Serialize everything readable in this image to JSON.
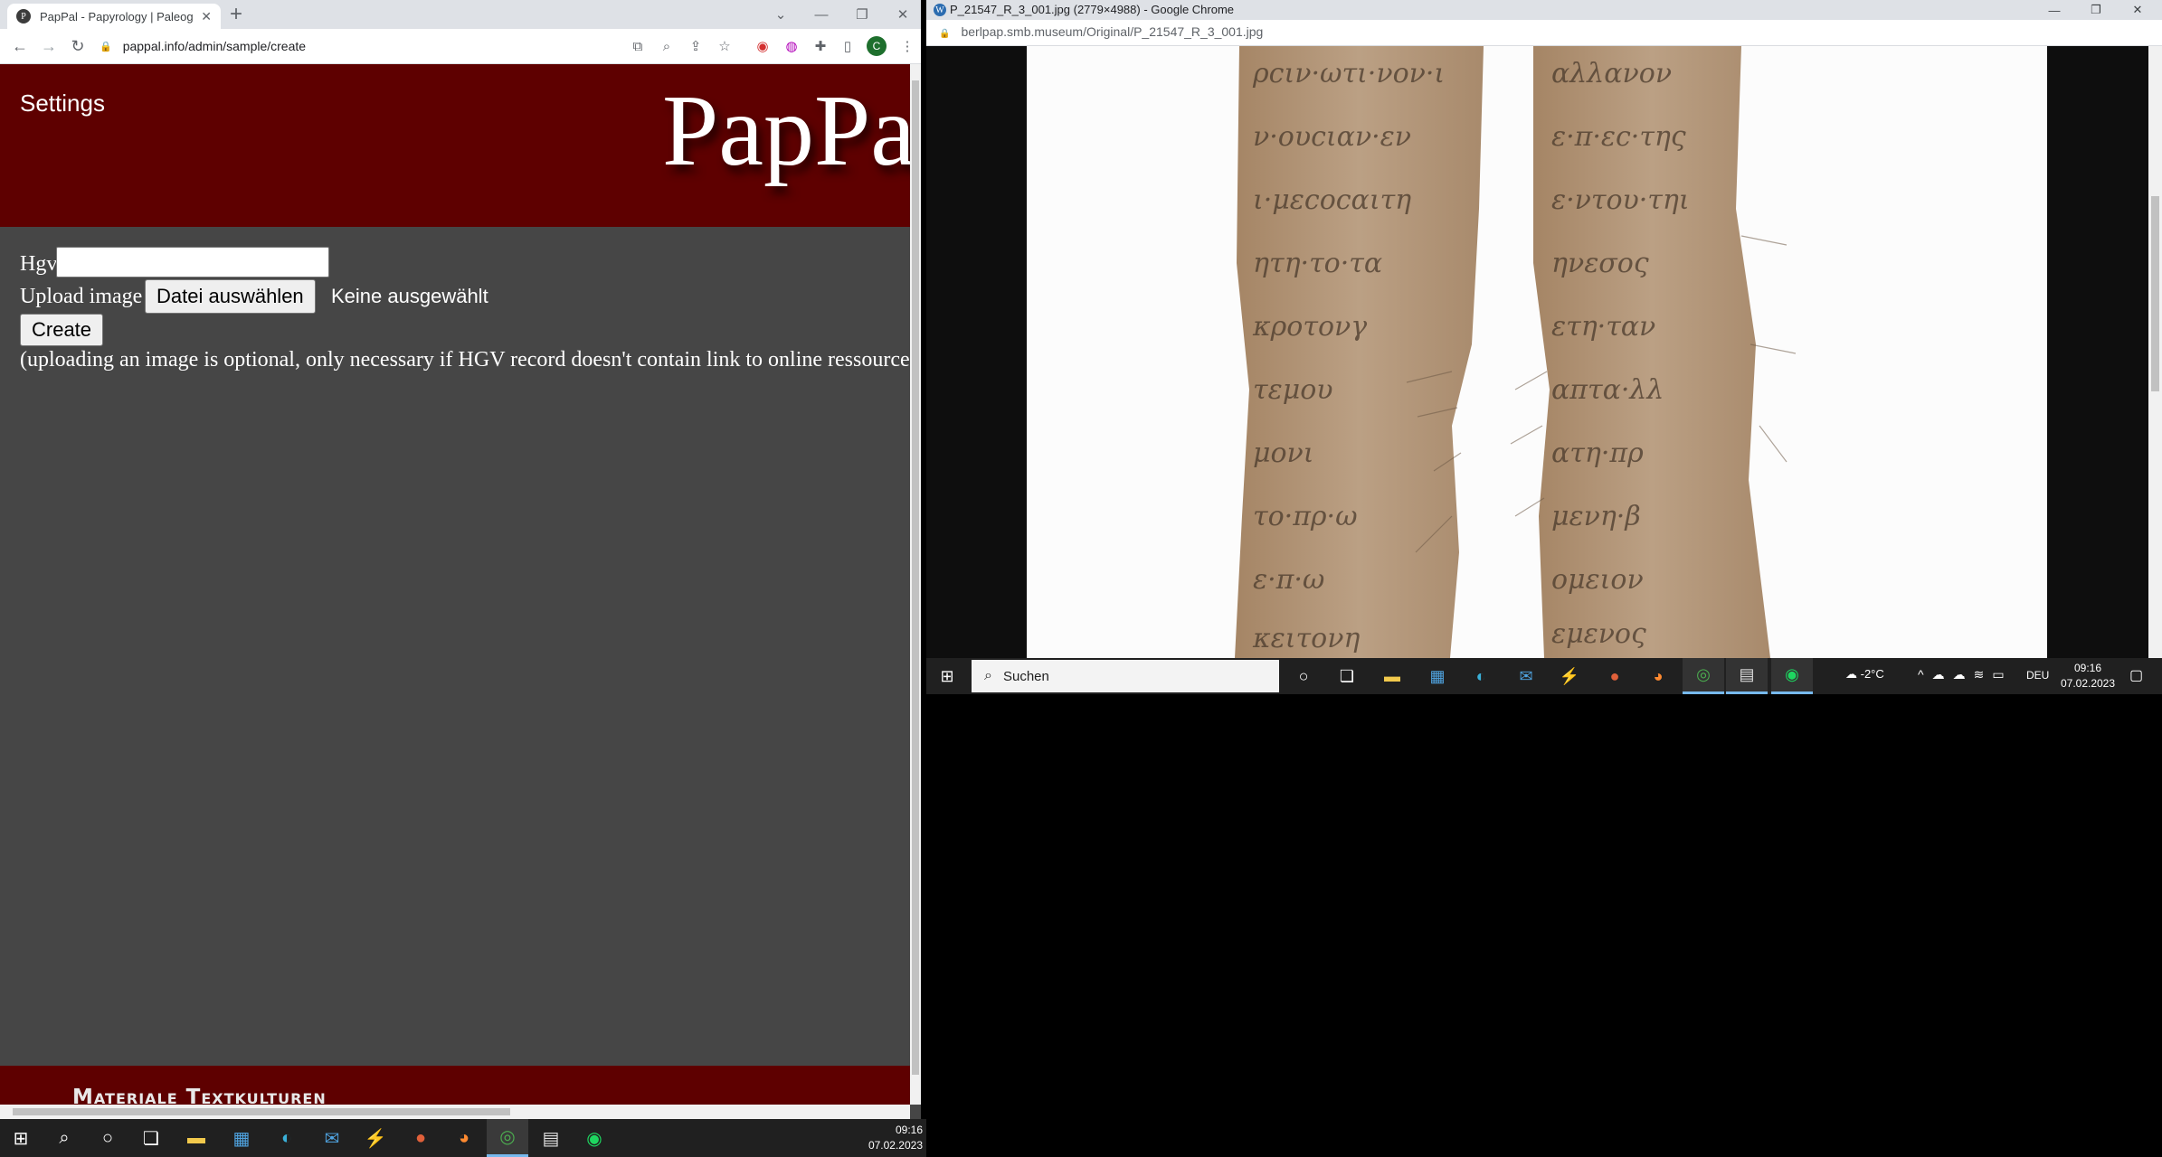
{
  "left_browser": {
    "tab_title": "PapPal - Papyrology | Paleograph",
    "tab_favicon_glyph": "P",
    "new_tab_glyph": "+",
    "url": "pappal.info/admin/sample/create",
    "profile_initial": "C",
    "toolbar_icons": [
      "translate-icon",
      "zoom-icon",
      "share-icon",
      "star-icon",
      "extension-red-icon",
      "extension-purple-icon",
      "puzzle-icon",
      "sidepanel-icon"
    ],
    "page": {
      "settings_link": "Settings",
      "logo_text": "PapPal",
      "hgv_label": "Hgv",
      "hgv_value": "",
      "upload_label": "Upload image",
      "file_button": "Datei auswählen",
      "file_status": "Keine ausgewählt",
      "create_button": "Create",
      "note": "(uploading an image is optional, only necessary if HGV record doesn't contain link to online ressources)",
      "footer_title": "Materiale Textkulturen"
    }
  },
  "left_taskbar": {
    "time": "09:16",
    "date": "07.02.2023",
    "apps": [
      "start-icon",
      "search-icon",
      "cortana-icon",
      "task-view-icon",
      "file-explorer-icon",
      "store-icon",
      "edge-icon",
      "mail-icon",
      "acrobat-icon",
      "powerpoint-icon",
      "firefox-icon",
      "chrome-icon",
      "notes-icon",
      "spotify-icon"
    ]
  },
  "right_browser": {
    "window_title": "P_21547_R_3_001.jpg (2779×4988) - Google Chrome",
    "url": "berlpap.smb.museum/Original/P_21547_R_3_001.jpg",
    "image_alt": "papyrus fragment P 21547"
  },
  "right_taskbar": {
    "search_placeholder": "Suchen",
    "weather": "-2°C",
    "language": "DEU",
    "time": "09:16",
    "date": "07.02.2023",
    "apps": [
      "cortana-icon",
      "task-view-icon",
      "file-explorer-icon",
      "store-icon",
      "edge-icon",
      "mail-icon",
      "acrobat-icon",
      "powerpoint-icon",
      "firefox-icon",
      "chrome-icon",
      "notes-icon",
      "spotify-icon"
    ]
  },
  "colors": {
    "header_red": "#5e0000",
    "page_bg": "#464646",
    "taskbar": "#202020",
    "papyrus": "#b5987a"
  }
}
